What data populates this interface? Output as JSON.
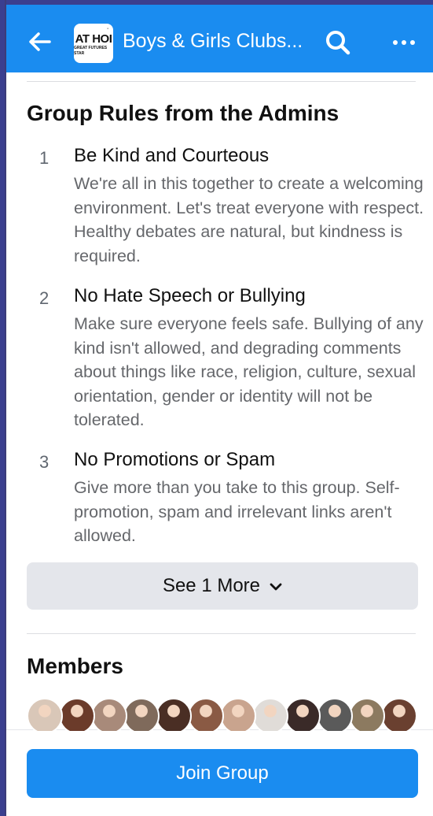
{
  "header": {
    "avatar_big_text": "AT HOI",
    "avatar_small_text": "GREAT FUTURES STAR",
    "title": "Boys & Girls Clubs...",
    "back_icon": "arrow-left-icon",
    "search_icon": "search-icon",
    "more_icon": "more-horizontal-icon"
  },
  "rules_section": {
    "title": "Group Rules from the Admins",
    "rules": [
      {
        "number": "1",
        "title": "Be Kind and Courteous",
        "description": "We're all in this together to create a welcoming environment. Let's treat everyone with respect. Healthy debates are natural, but kindness is required."
      },
      {
        "number": "2",
        "title": "No Hate Speech or Bullying",
        "description": "Make sure everyone feels safe. Bullying of any kind isn't allowed, and degrading comments about things like race, religion, culture, sexual orientation, gender or identity will not be tolerated."
      },
      {
        "number": "3",
        "title": "No Promotions or Spam",
        "description": "Give more than you take to this group. Self-promotion, spam and irrelevant links aren't allowed."
      }
    ],
    "see_more_label": "See 1 More"
  },
  "members": {
    "title": "Members",
    "avatar_colors": [
      "#d9c7b8",
      "#6b3b2a",
      "#a88a7a",
      "#7f6a5b",
      "#4a2e24",
      "#8a5a44",
      "#c9a48e",
      "#e0dcd8",
      "#3a2a28",
      "#5a5a5a",
      "#8c7a60",
      "#6a4030"
    ]
  },
  "footer": {
    "join_label": "Join Group"
  },
  "colors": {
    "brand_blue": "#1a8cf0",
    "button_gray": "#e4e6eb",
    "secondary_text": "#65676b"
  }
}
